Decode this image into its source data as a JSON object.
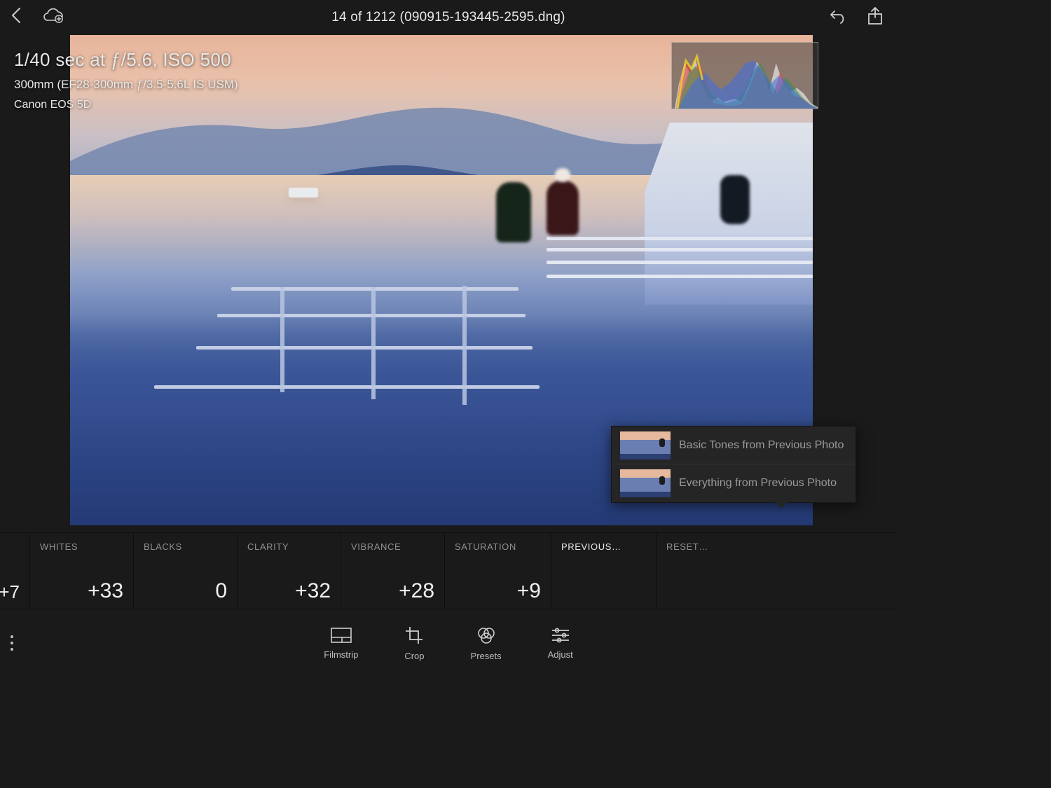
{
  "header": {
    "title": "14 of 1212 (090915-193445-2595.dng)"
  },
  "metadata": {
    "exposure": "1/40 sec at ƒ/5.6, ISO 500",
    "lens": "300mm (EF28-300mm ƒ/3.5-5.6L IS USM)",
    "camera": "Canon EOS 5D"
  },
  "popup": {
    "items": [
      {
        "label": "Basic Tones from Previous Photo"
      },
      {
        "label": "Everything from Previous Photo"
      }
    ]
  },
  "sliders": {
    "leading_value": "+7",
    "cells": [
      {
        "label": "WHITES",
        "value": "+33"
      },
      {
        "label": "BLACKS",
        "value": "0"
      },
      {
        "label": "CLARITY",
        "value": "+32"
      },
      {
        "label": "VIBRANCE",
        "value": "+28"
      },
      {
        "label": "SATURATION",
        "value": "+9"
      }
    ],
    "actions": [
      {
        "label": "PREVIOUS…"
      },
      {
        "label": "RESET…"
      }
    ]
  },
  "toolbar": {
    "items": [
      {
        "label": "Filmstrip"
      },
      {
        "label": "Crop"
      },
      {
        "label": "Presets"
      },
      {
        "label": "Adjust"
      }
    ]
  }
}
